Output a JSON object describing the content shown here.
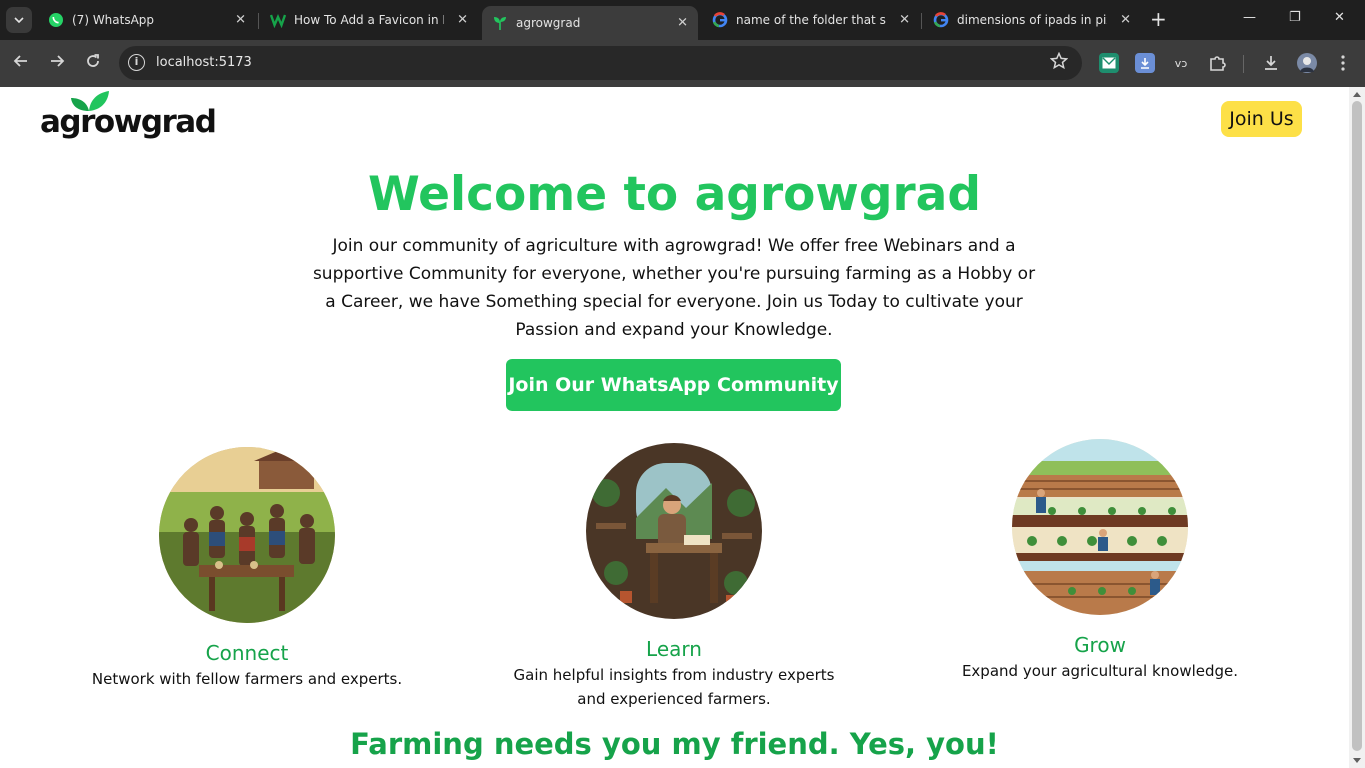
{
  "browser": {
    "tabs": [
      {
        "title": "(7) WhatsApp",
        "icon": "whatsapp-icon"
      },
      {
        "title": "How To Add a Favicon in HTML",
        "icon": "w-logo-icon"
      },
      {
        "title": "agrowgrad",
        "icon": "sprout-icon",
        "active": true
      },
      {
        "title": "name of the folder that stores",
        "icon": "google-icon"
      },
      {
        "title": "dimensions of ipads in pixels",
        "icon": "google-icon"
      }
    ],
    "url": "localhost:5173",
    "new_tab": "+",
    "close_glyph": "✕",
    "window_controls": {
      "minimize": "—",
      "restore": "❐",
      "close": "✕"
    },
    "extensions": {
      "vo_label": "vɔ"
    }
  },
  "page": {
    "logo_text": "agrowgrad",
    "header_button": "Join Us",
    "hero": {
      "title": "Welcome to agrowgrad",
      "text": "Join our community of agriculture with agrowgrad! We offer free Webinars and a supportive Community for everyone, whether you're pursuing farming as a Hobby or a Career, we have Something special for everyone. Join us Today to cultivate your Passion and expand your Knowledge.",
      "cta": "Join Our WhatsApp Community"
    },
    "features": [
      {
        "title": "Connect",
        "desc": "Network with fellow farmers and experts."
      },
      {
        "title": "Learn",
        "desc": "Gain helpful insights from industry experts and experienced farmers."
      },
      {
        "title": "Grow",
        "desc": "Expand your agricultural knowledge."
      }
    ],
    "footer_line": "Farming needs you my friend. Yes, you!"
  },
  "colors": {
    "primary_green": "#22c55e",
    "dark_green": "#16a34a",
    "join_yellow": "#fde047"
  }
}
